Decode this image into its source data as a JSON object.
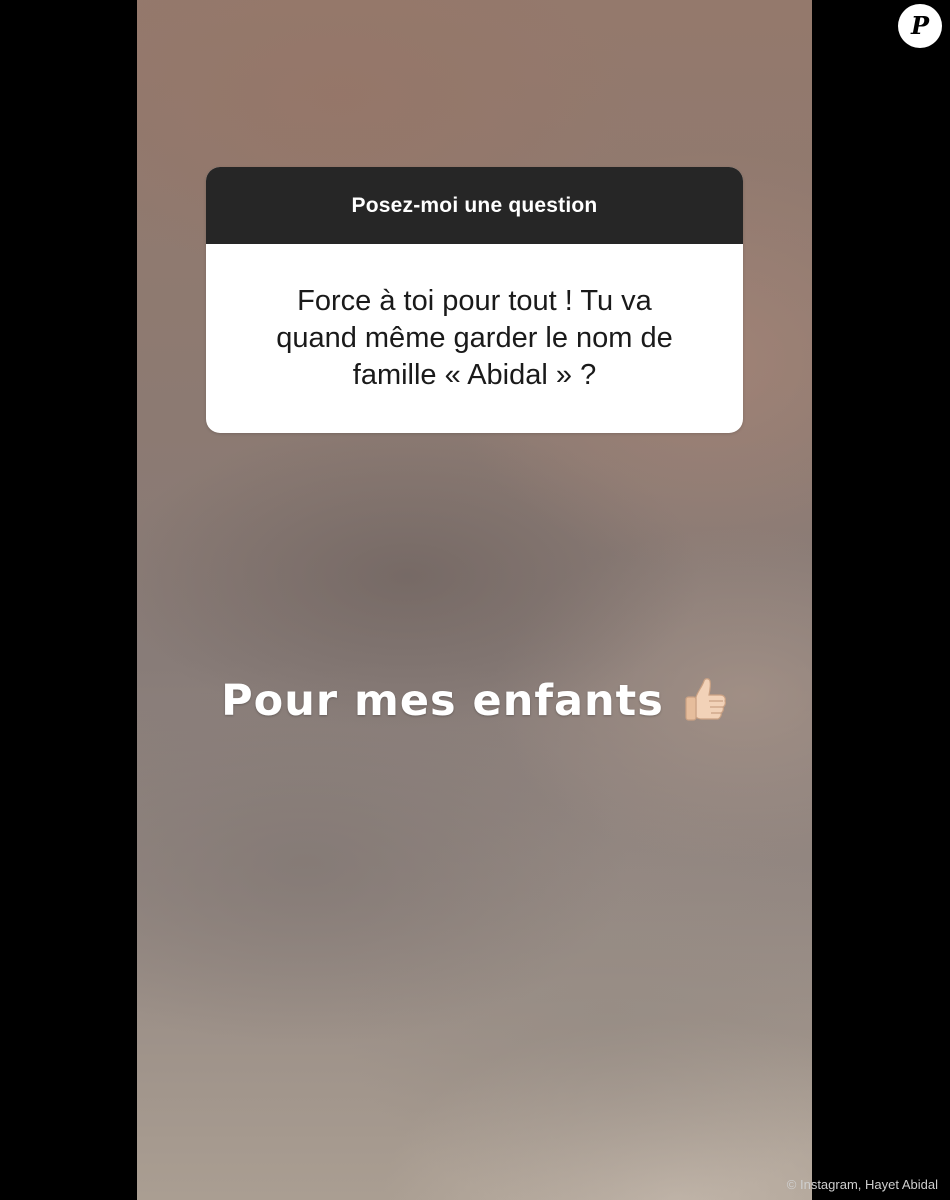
{
  "question_sticker": {
    "header": "Posez-moi une question",
    "lines": [
      "Force à toi pour tout ! Tu va",
      "quand même garder le nom de",
      "famille « Abidal » ?"
    ]
  },
  "answer": {
    "text": "Pour mes enfants",
    "emoji_icon": "thumbs-up-icon"
  },
  "watermark": {
    "logo_letter": "P"
  },
  "credit": "© Instagram, Hayet Abidal",
  "colors": {
    "page_background": "#000000",
    "sticker_header": "#262626",
    "sticker_body": "#ffffff",
    "answer_text": "#ffffff"
  }
}
